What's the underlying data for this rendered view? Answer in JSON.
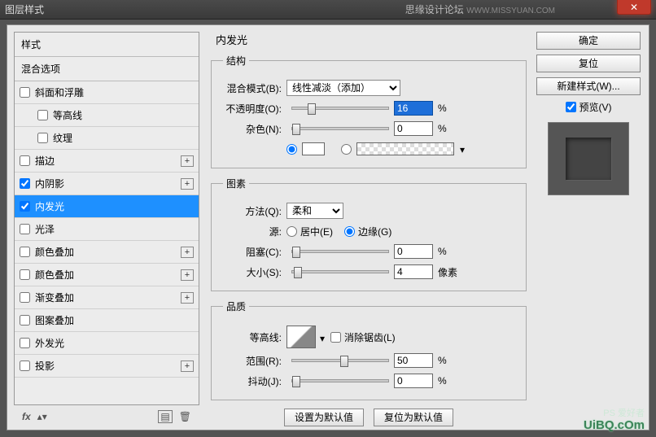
{
  "titlebar": {
    "title": "图层样式",
    "brand": "思缘设计论坛",
    "brandurl": "WWW.MISSYUAN.COM"
  },
  "left": {
    "header_styles": "样式",
    "header_blend": "混合选项",
    "items": [
      {
        "label": "斜面和浮雕",
        "checked": false,
        "plus": false,
        "sub": false
      },
      {
        "label": "等高线",
        "checked": false,
        "plus": false,
        "sub": true
      },
      {
        "label": "纹理",
        "checked": false,
        "plus": false,
        "sub": true
      },
      {
        "label": "描边",
        "checked": false,
        "plus": true,
        "sub": false
      },
      {
        "label": "内阴影",
        "checked": true,
        "plus": true,
        "sub": false
      },
      {
        "label": "内发光",
        "checked": true,
        "plus": false,
        "sub": false,
        "selected": true
      },
      {
        "label": "光泽",
        "checked": false,
        "plus": false,
        "sub": false
      },
      {
        "label": "颜色叠加",
        "checked": false,
        "plus": true,
        "sub": false
      },
      {
        "label": "颜色叠加",
        "checked": false,
        "plus": true,
        "sub": false
      },
      {
        "label": "渐变叠加",
        "checked": false,
        "plus": true,
        "sub": false
      },
      {
        "label": "图案叠加",
        "checked": false,
        "plus": false,
        "sub": false
      },
      {
        "label": "外发光",
        "checked": false,
        "plus": false,
        "sub": false
      },
      {
        "label": "投影",
        "checked": false,
        "plus": true,
        "sub": false
      }
    ],
    "footer_fx": "fx"
  },
  "right": {
    "ok": "确定",
    "reset": "复位",
    "newstyle": "新建样式(W)...",
    "preview": "预览(V)"
  },
  "panel": {
    "title": "内发光",
    "struct": {
      "legend": "结构",
      "blend_label": "混合模式(B):",
      "blend_value": "线性减淡（添加）",
      "opacity_label": "不透明度(O):",
      "opacity_value": "16",
      "opacity_unit": "%",
      "noise_label": "杂色(N):",
      "noise_value": "0",
      "noise_unit": "%"
    },
    "elements": {
      "legend": "图素",
      "method_label": "方法(Q):",
      "method_value": "柔和",
      "source_label": "源:",
      "source_center": "居中(E)",
      "source_edge": "边缘(G)",
      "choke_label": "阻塞(C):",
      "choke_value": "0",
      "choke_unit": "%",
      "size_label": "大小(S):",
      "size_value": "4",
      "size_unit": "像素"
    },
    "quality": {
      "legend": "品质",
      "contour_label": "等高线:",
      "antialias": "消除锯齿(L)",
      "range_label": "范围(R):",
      "range_value": "50",
      "range_unit": "%",
      "jitter_label": "抖动(J):",
      "jitter_value": "0",
      "jitter_unit": "%"
    },
    "defaults": {
      "set": "设置为默认值",
      "reset": "复位为默认值"
    }
  },
  "watermark": {
    "line1": "PS 爱好者",
    "line2": "UiBQ.cOm"
  }
}
